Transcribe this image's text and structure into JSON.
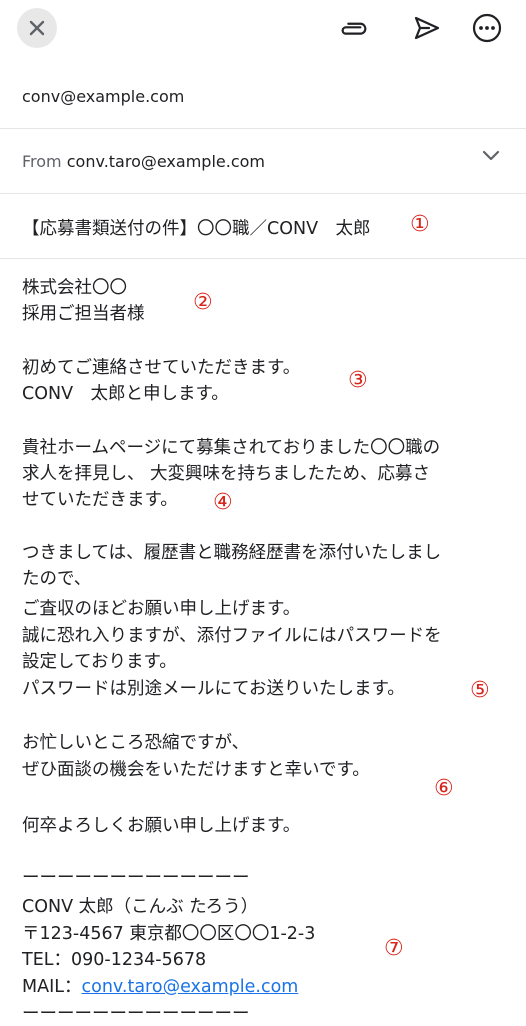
{
  "toolbar": {
    "close_icon": "close-icon",
    "attach_icon": "paperclip-icon",
    "send_icon": "send-icon",
    "more_icon": "more-horizontal-icon"
  },
  "to": {
    "value": "conv@example.com"
  },
  "from": {
    "label": "From",
    "value": "conv.taro@example.com"
  },
  "subject": {
    "value": "【応募書類送付の件】〇〇職／CONV　太郎"
  },
  "markers": [
    "①",
    "②",
    "③",
    "④",
    "⑤",
    "⑥",
    "⑦"
  ],
  "body": {
    "lines": [
      "株式会社〇〇",
      "採用ご担当者様",
      "初めてご連絡させていただきます。",
      "CONV　太郎と申します。",
      "貴社ホームページにて募集されておりました〇〇職の",
      "求人を拝見し、 大変興味を持ちましたため、応募さ",
      "せていただきます。",
      "つきましては、履歴書と職務経歴書を添付いたしまし",
      "たので、",
      "ご査収のほどお願い申し上げます。",
      "誠に恐れ入りますが、添付ファイルにはパスワードを",
      "設定しております。",
      "パスワードは別途メールにてお送りいたします。",
      "お忙しいところ恐縮ですが、",
      "ぜひ面談の機会をいただけますと幸いです。",
      "何卒よろしくお願い申し上げます。"
    ]
  },
  "signature": {
    "rule_top": "ーーーーーーーーーーーーー",
    "name": "CONV 太郎（こんぶ たろう）",
    "address": "〒123-4567 東京都〇〇区〇〇1-2-3",
    "tel": "TEL：090-1234-5678",
    "mail_label": "MAIL：",
    "mail_link": "conv.taro@example.com",
    "rule_bottom": "ーーーーーーーーーーーーー"
  },
  "colors": {
    "marker": "#d8261c",
    "link": "#1a73e8"
  }
}
